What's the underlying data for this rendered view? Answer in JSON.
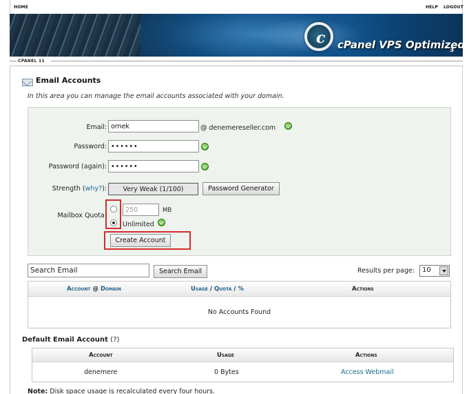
{
  "topbar": {
    "home": "HOME",
    "help": "HELP",
    "logout": "LOGOUT"
  },
  "banner": {
    "logo_letter": "c",
    "title": "cPanel VPS Optimized",
    "version": "3"
  },
  "subbar": {
    "tab": "CPANEL 11"
  },
  "section": {
    "icon": "mail-icon",
    "title": "Email Accounts",
    "intro": "In this area you can manage the email accounts associated with your domain."
  },
  "form": {
    "email_label": "Email:",
    "email_value": "ornek",
    "domain": "@ denemereseller.com",
    "password_label": "Password:",
    "password_value": "••••••",
    "password_again_label": "Password (again):",
    "password_again_value": "••••••",
    "strength_label": "Strength (",
    "strength_why": "why?",
    "strength_close": "):",
    "strength_value": "Very Weak (1/100)",
    "password_generator": "Password Generator",
    "quota_label": "Mailbox Quota:",
    "quota_value": "250",
    "quota_unit": "MB",
    "quota_unlimited": "Unlimited",
    "quota_selected": "unlimited",
    "create_button": "Create Account"
  },
  "search": {
    "value": "Search Email",
    "button": "Search Email",
    "results_label": "Results per page:",
    "results_value": "10"
  },
  "accounts_table": {
    "col_account": "Account",
    "col_at": "@",
    "col_domain": "Domain",
    "col_usage": "Usage",
    "col_slash1": "/",
    "col_quota": "Quota",
    "col_slash2": "/",
    "col_pct": "%",
    "col_actions": "Actions",
    "empty": "No Accounts Found"
  },
  "default_account": {
    "title": "Default Email Account",
    "help": "(?)",
    "col_account": "Account",
    "col_usage": "Usage",
    "col_actions": "Actions",
    "row_account": "denemere",
    "row_usage": "0 Bytes",
    "row_action": "Access Webmail"
  },
  "note": {
    "label": "Note:",
    "text": " Disk space usage is recalculated every four hours."
  },
  "colors": {
    "highlight": "#d42b2b",
    "link": "#1a5f8a",
    "ok": "#3b9a1e"
  }
}
